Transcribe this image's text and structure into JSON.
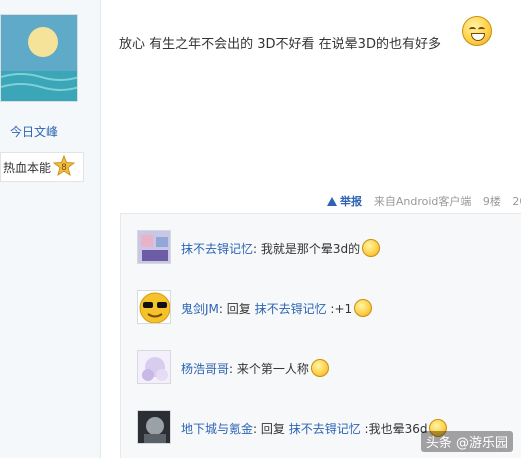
{
  "poster": {
    "username": "今日文峰",
    "title_label": "热血本能",
    "level": "8"
  },
  "post": {
    "text": "放心 有生之年不会出的 3D不好看 在说晕3D的也有好多",
    "report_label": "举报",
    "source": "来自Android客户端",
    "floor": "9楼",
    "date_fragment": "20"
  },
  "comments": [
    {
      "user": "抹不去锝记忆",
      "sep": ":",
      "reply_prefix": "",
      "reply_to": "",
      "text": " 我就是那个晕3d的"
    },
    {
      "user": "鬼剑JM",
      "sep": ":",
      "reply_prefix": " 回复 ",
      "reply_to": "抹不去锝记忆",
      "text": " :+1"
    },
    {
      "user": "杨浩哥哥",
      "sep": ":",
      "reply_prefix": "",
      "reply_to": "",
      "text": " 来个第一人称"
    },
    {
      "user": "地下城与氪金",
      "sep": ":",
      "reply_prefix": " 回复 ",
      "reply_to": "抹不去锝记忆",
      "text": " :我也晕36d"
    }
  ],
  "watermark": "头条 @游乐园",
  "icons": {
    "report": "warning-icon",
    "emoji": "smiley-emoji-icon",
    "level": "star-badge-icon"
  }
}
